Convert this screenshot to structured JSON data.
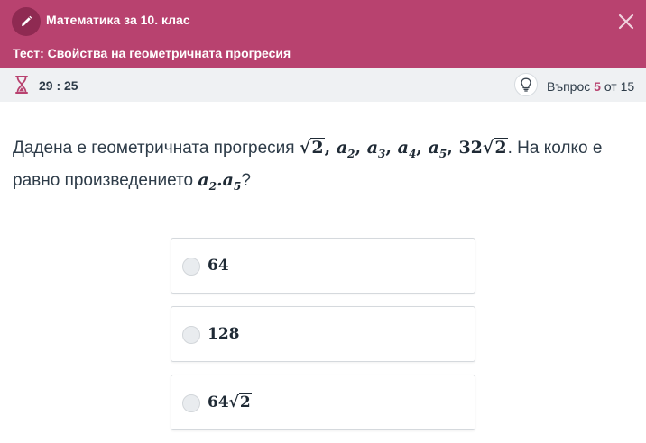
{
  "header": {
    "course_title": "Математика за 10. клас",
    "test_title": "Тест: Свойства на геометричната прогресия",
    "edit_icon": "pencil-icon",
    "close_icon": "close-icon",
    "colors": {
      "accent": "#b8426f",
      "accent_dark": "#8f2a52"
    }
  },
  "status": {
    "timer_icon": "hourglass-icon",
    "timer": "29 : 25",
    "hint_icon": "lightbulb-icon",
    "question_label": "Въпрос",
    "question_current": "5",
    "question_of": "от",
    "question_total": "15"
  },
  "question": {
    "text_before": "Дадена е геометричната прогресия ",
    "sequence": {
      "first": "2",
      "terms": [
        "a",
        "a",
        "a",
        "a"
      ],
      "term_subs": [
        "2",
        "3",
        "4",
        "5"
      ],
      "last_coef": "32",
      "last_root": "2"
    },
    "text_after": ". На колко е равно произведението ",
    "product": {
      "a": "a",
      "sub1": "2",
      "dot": ".",
      "sub2": "5"
    },
    "end": "?"
  },
  "options": [
    {
      "text": "64"
    },
    {
      "text": "128"
    },
    {
      "coef": "64",
      "root": "2"
    }
  ]
}
